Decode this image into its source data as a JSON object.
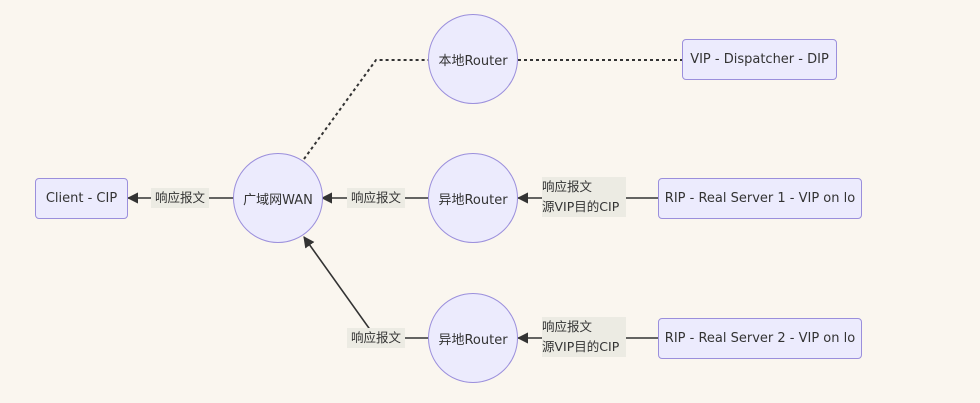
{
  "nodes": {
    "client": "Client - CIP",
    "wan": "广域网WAN",
    "local_router": "本地Router",
    "dispatcher": "VIP - Dispatcher - DIP",
    "remote_router_1": "异地Router",
    "remote_router_2": "异地Router",
    "real_server_1": "RIP - Real Server 1 - VIP on lo",
    "real_server_2": "RIP - Real Server 2 - VIP on lo"
  },
  "edges": {
    "wan_to_client": "响应报文",
    "router1_to_wan": "响应报文",
    "router2_to_wan": "响应报文",
    "rs1_to_router1": [
      "响应报文",
      "源VIP目的CIP"
    ],
    "rs2_to_router2": [
      "响应报文",
      "源VIP目的CIP"
    ]
  },
  "colors": {
    "background": "#faf6ef",
    "node_fill": "#ecebfd",
    "node_border": "#9b8fdc",
    "edge": "#333333"
  }
}
